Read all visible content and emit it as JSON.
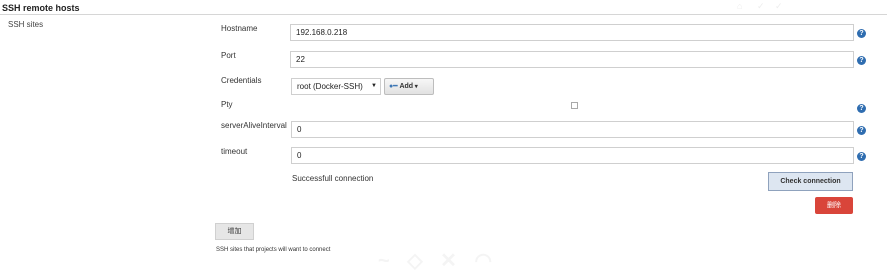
{
  "section": {
    "title": "SSH remote hosts"
  },
  "ssh_sites": {
    "label": "SSH sites",
    "help_text": "SSH sites that projects will want to connect"
  },
  "fields": {
    "hostname": {
      "label": "Hostname",
      "value": "192.168.0.218"
    },
    "port": {
      "label": "Port",
      "value": "22"
    },
    "credentials": {
      "label": "Credentials",
      "selected": "root (Docker-SSH)",
      "add_label": "Add"
    },
    "pty": {
      "label": "Pty",
      "checked": false
    },
    "server_alive_interval": {
      "label": "serverAliveInterval",
      "value": "0"
    },
    "timeout": {
      "label": "timeout",
      "value": "0"
    }
  },
  "status": {
    "connection_message": "Successfull connection"
  },
  "buttons": {
    "check_connection": "Check connection",
    "delete": "删除",
    "add_site": "增加"
  },
  "colors": {
    "help_icon": "#2f6db0",
    "delete_button": "#d9453a",
    "check_button": "#dde6f1"
  },
  "icons": {
    "help": "question-circle-icon",
    "key": "key-icon",
    "caret": "caret-down-icon"
  }
}
